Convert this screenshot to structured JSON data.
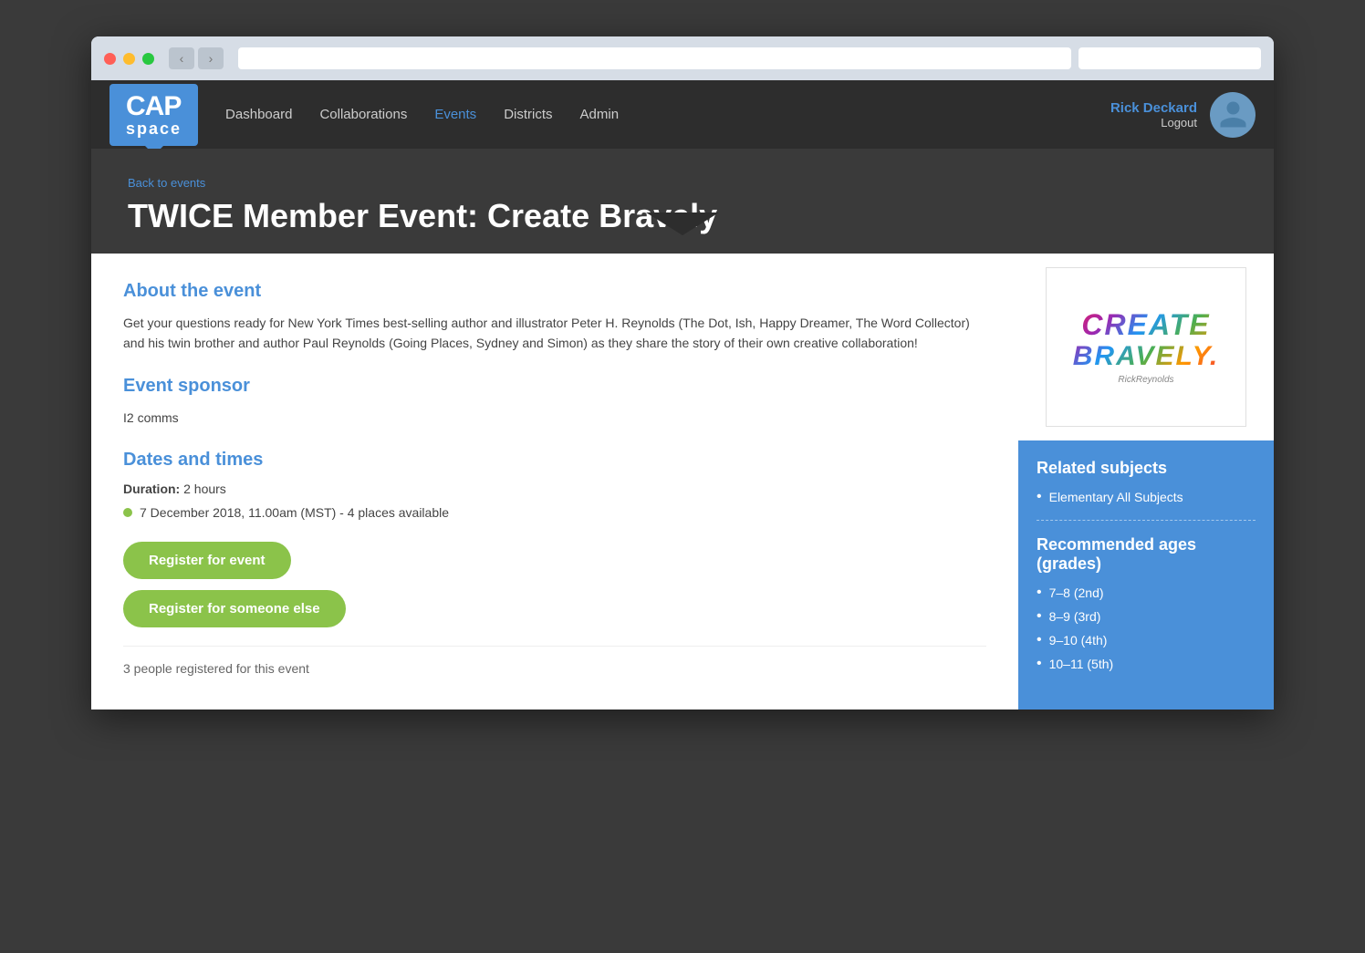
{
  "browser": {
    "back_label": "‹",
    "forward_label": "›"
  },
  "nav": {
    "logo_cap": "CAP",
    "logo_space": "space",
    "links": [
      {
        "label": "Dashboard",
        "active": false
      },
      {
        "label": "Collaborations",
        "active": false
      },
      {
        "label": "Events",
        "active": true
      },
      {
        "label": "Districts",
        "active": false
      },
      {
        "label": "Admin",
        "active": false
      }
    ],
    "user_name": "Rick Deckard",
    "user_logout": "Logout"
  },
  "page": {
    "back_link": "Back to events",
    "title": "TWICE Member Event: Create Bravely"
  },
  "event": {
    "about_heading": "About the event",
    "about_text": "Get your questions ready for New York Times best-selling author and illustrator Peter H. Reynolds (The Dot, Ish, Happy Dreamer, The Word Collector) and his twin brother and author Paul Reynolds (Going Places, Sydney and Simon) as they share the story of their own creative collaboration!",
    "sponsor_heading": "Event sponsor",
    "sponsor_name": "I2 comms",
    "dates_heading": "Dates and times",
    "duration_label": "Duration:",
    "duration_value": "2 hours",
    "date_entry": "7 December 2018, 11.00am (MST) - 4 places available",
    "register_btn": "Register for event",
    "register_other_btn": "Register for someone else",
    "registered_count": "3 people registered for this event"
  },
  "sidebar": {
    "image_text_line1": "CREATE",
    "image_text_line2": "BRAVELY.",
    "image_signature": "RickReynolds",
    "related_heading": "Related subjects",
    "related_items": [
      {
        "label": "Elementary All Subjects"
      }
    ],
    "ages_heading": "Recommended ages (grades)",
    "age_items": [
      {
        "label": "7–8 (2nd)"
      },
      {
        "label": "8–9 (3rd)"
      },
      {
        "label": "9–10 (4th)"
      },
      {
        "label": "10–11 (5th)"
      }
    ]
  }
}
